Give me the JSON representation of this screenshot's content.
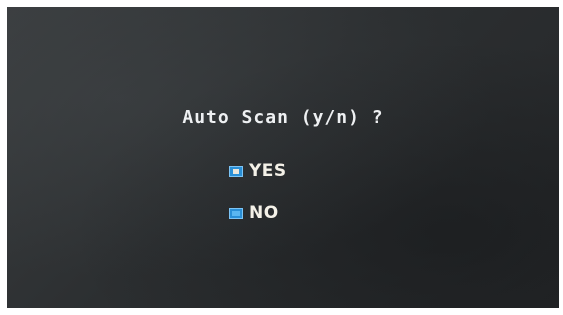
{
  "dialog": {
    "question": "Auto Scan (y/n) ?",
    "options": [
      {
        "label": "YES",
        "selected": true
      },
      {
        "label": "NO",
        "selected": false
      }
    ]
  },
  "colors": {
    "background": "#2c2f31",
    "text": "#eef0f2",
    "radio_accent": "#2a8fd6"
  }
}
